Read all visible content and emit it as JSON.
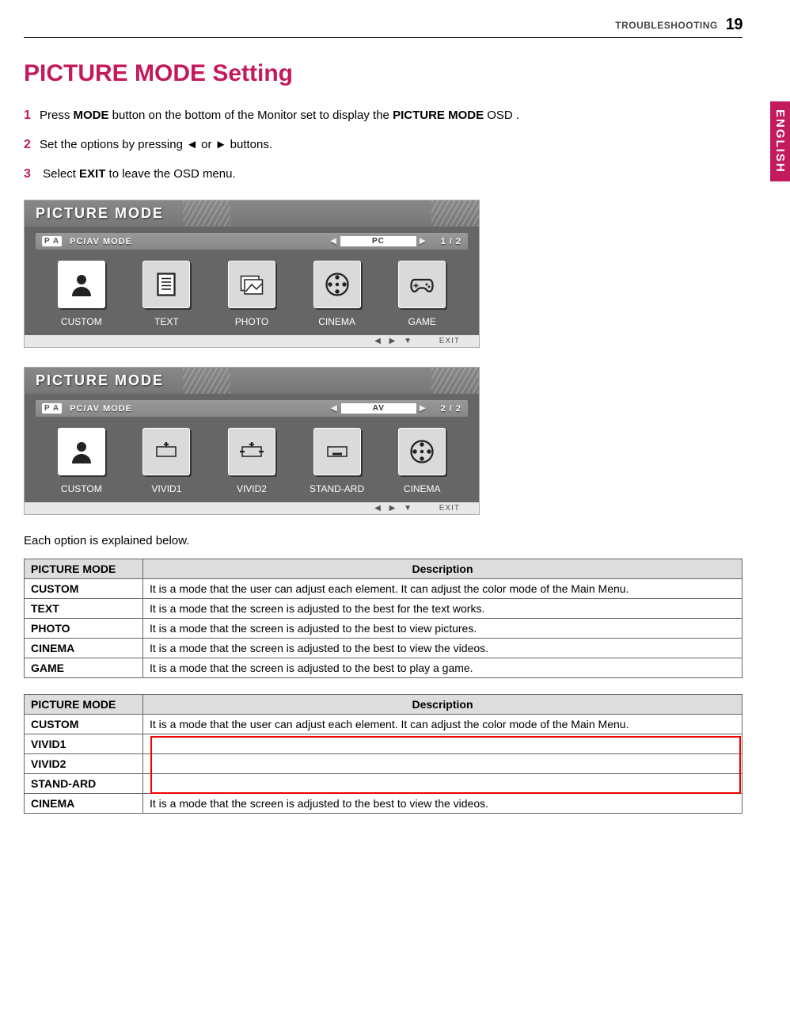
{
  "header": {
    "section": "TROUBLESHOOTING",
    "page_num": "19"
  },
  "side_tab": "ENGLISH",
  "title": "PICTURE MODE Setting",
  "steps": {
    "s1a": "Press ",
    "s1b": "MODE",
    "s1c": "  button on the bottom of the Monitor set to display the ",
    "s1d": "PICTURE MODE",
    "s1e": " OSD .",
    "s2a": "Set the options by pressing ◄ or ► buttons.",
    "s3a": " Select ",
    "s3b": "EXIT",
    "s3c": " to leave the OSD menu."
  },
  "osd1": {
    "title": "PICTURE  MODE",
    "pa": "P A",
    "sublabel": "PC/AV  MODE",
    "value": "PC",
    "count": "1 / 2",
    "options": [
      "CUSTOM",
      "TEXT",
      "PHOTO",
      "CINEMA",
      "GAME"
    ],
    "footer_nav": "◀   ▶   ▼",
    "exit": "EXIT"
  },
  "osd2": {
    "title": "PICTURE  MODE",
    "pa": "P A",
    "sublabel": "PC/AV  MODE",
    "value": "AV",
    "count": "2 / 2",
    "options": [
      "CUSTOM",
      "VIVID1",
      "VIVID2",
      "STAND-ARD",
      "CINEMA"
    ],
    "footer_nav": "◀   ▶   ▼",
    "exit": "EXIT"
  },
  "desc_line": "Each option is explained below.",
  "table1": {
    "h1": "PICTURE MODE",
    "h2": "Description",
    "rows": [
      {
        "name": "CUSTOM",
        "desc": "It is a mode that the user can adjust each element. It can adjust the color mode of the Main Menu."
      },
      {
        "name": "TEXT",
        "desc": "It is a mode that the screen is adjusted to the best for the text works."
      },
      {
        "name": "PHOTO",
        "desc": "It is a mode that the screen is adjusted to the best to view pictures."
      },
      {
        "name": "CINEMA",
        "desc": "It is a mode that the screen is adjusted to the best to view the videos."
      },
      {
        "name": "GAME",
        "desc": "It is a mode that the screen is adjusted to the best to play a game."
      }
    ]
  },
  "table2": {
    "h1": "PICTURE MODE",
    "h2": "Description",
    "rows": [
      {
        "name": "CUSTOM",
        "desc": "It is a mode that the user can adjust each element. It can adjust the color mode of the Main Menu."
      },
      {
        "name": "VIVID1",
        "desc": ""
      },
      {
        "name": "VIVID2",
        "desc": ""
      },
      {
        "name": "STAND-ARD",
        "desc": ""
      },
      {
        "name": "CINEMA",
        "desc": "It is a mode that the screen is adjusted to the best to view the videos."
      }
    ]
  }
}
